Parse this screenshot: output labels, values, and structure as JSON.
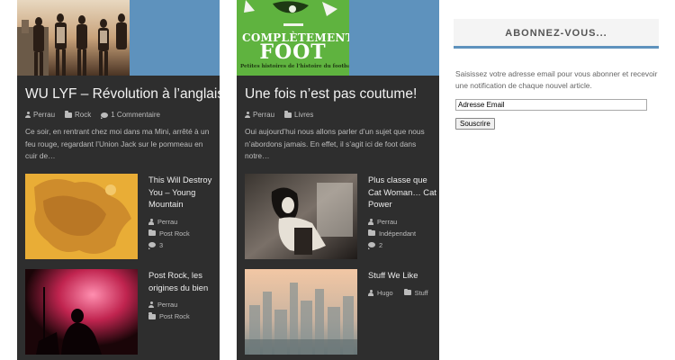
{
  "posts": [
    {
      "title": "WU LYF – Révolution à l’anglaise",
      "author": "Perrau",
      "category": "Rock",
      "comments": "1 Commentaire",
      "excerpt": "Ce soir, en rentrant chez moi dans ma Mini, arrêté à un feu rouge, regardant l’Union Jack sur le pommeau en cuir de…",
      "related": [
        {
          "title": "This Will Destroy You – Young Mountain",
          "author": "Perrau",
          "category": "Post Rock",
          "comments": "3"
        },
        {
          "title": "Post Rock, les origines du bien",
          "author": "Perrau",
          "category": "Post Rock",
          "comments": ""
        }
      ]
    },
    {
      "title": "Une fois n’est pas coutume!",
      "author": "Perrau",
      "category": "Livres",
      "comments": "",
      "excerpt": "Oui aujourd’hui nous allons parler d’un sujet que nous n’abordons jamais. En effet, il s’agit ici de foot dans notre…",
      "book_cover": {
        "title": "COMPLÈTEMENT FOOT",
        "subtitle": "Petites histoires de l’histoire du football"
      },
      "related": [
        {
          "title": "Plus classe que Cat Woman… Cat Power",
          "author": "Perrau",
          "category": "Indépendant",
          "comments": "2"
        },
        {
          "title": "Stuff We Like",
          "author": "Hugo",
          "category": "Stuff",
          "comments": ""
        }
      ]
    }
  ],
  "sidebar": {
    "widget_title": "ABONNEZ-VOUS...",
    "description": "Saisissez votre adresse email pour vous abonner et recevoir une notification de chaque nouvel article.",
    "email_value": "Adresse Email",
    "button_label": "Souscrire"
  },
  "colors": {
    "accent": "#5e92bd",
    "card_bg": "#2e2e2e",
    "book_green": "#5fb33f"
  }
}
